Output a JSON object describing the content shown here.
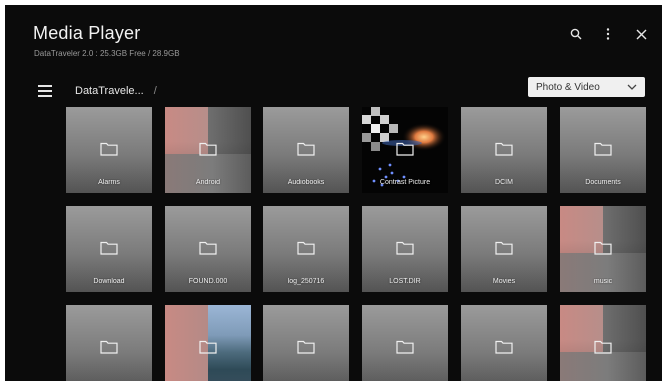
{
  "header": {
    "title": "Media Player",
    "subtitle": "DataTraveler 2.0 : 25.3GB Free / 28.9GB"
  },
  "toolbar": {
    "search_icon": "search-icon",
    "more_icon": "more-vertical-icon",
    "close_icon": "close-icon"
  },
  "nav": {
    "menu_icon": "hamburger-menu-icon",
    "breadcrumb": "DataTravele...",
    "separator": "/"
  },
  "filter": {
    "selected": "Photo & Video"
  },
  "grid": {
    "rows": [
      [
        {
          "label": "Alarms",
          "thumb": "folder"
        },
        {
          "label": "Android",
          "thumb": "split"
        },
        {
          "label": "Audiobooks",
          "thumb": "folder"
        },
        {
          "label": "Contrast Picture",
          "thumb": "contrast"
        },
        {
          "label": "DCIM",
          "thumb": "folder"
        },
        {
          "label": "Documents",
          "thumb": "folder"
        }
      ],
      [
        {
          "label": "Download",
          "thumb": "folder"
        },
        {
          "label": "FOUND.000",
          "thumb": "folder"
        },
        {
          "label": "log_250716",
          "thumb": "folder"
        },
        {
          "label": "LOST.DIR",
          "thumb": "folder"
        },
        {
          "label": "Movies",
          "thumb": "folder"
        },
        {
          "label": "music",
          "thumb": "split"
        }
      ],
      [
        {
          "label": "",
          "thumb": "folder"
        },
        {
          "label": "",
          "thumb": "mountain"
        },
        {
          "label": "",
          "thumb": "folder"
        },
        {
          "label": "",
          "thumb": "folder"
        },
        {
          "label": "",
          "thumb": "folder"
        },
        {
          "label": "",
          "thumb": "split"
        }
      ]
    ]
  }
}
